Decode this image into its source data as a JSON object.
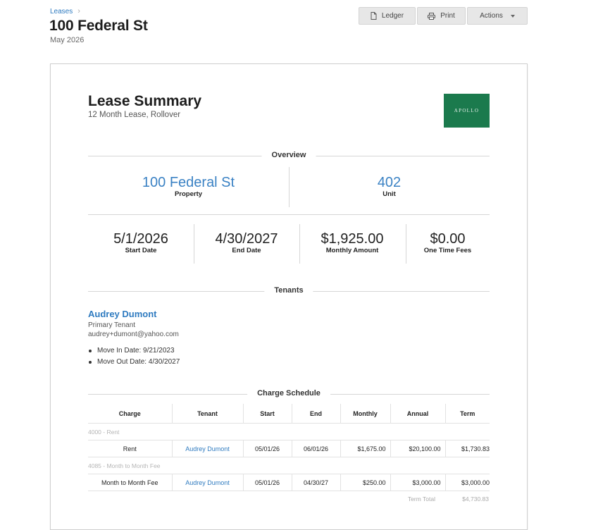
{
  "breadcrumb": {
    "parent": "Leases",
    "separator": "›"
  },
  "header": {
    "title": "100 Federal St",
    "subtitle": "May 2026"
  },
  "toolbar": {
    "ledger_label": "Ledger",
    "print_label": "Print",
    "actions_label": "Actions"
  },
  "document": {
    "title": "Lease Summary",
    "subtitle": "12 Month Lease, Rollover",
    "logo_text": "APOLLO",
    "logo_color": "#1b7a4d",
    "overview": {
      "heading": "Overview",
      "property_value": "100 Federal St",
      "property_label": "Property",
      "unit_value": "402",
      "unit_label": "Unit",
      "start_value": "5/1/2026",
      "start_label": "Start Date",
      "end_value": "4/30/2027",
      "end_label": "End Date",
      "monthly_value": "$1,925.00",
      "monthly_label": "Monthly Amount",
      "fees_value": "$0.00",
      "fees_label": "One Time Fees"
    },
    "tenants": {
      "heading": "Tenants",
      "name": "Audrey Dumont",
      "role": "Primary Tenant",
      "email": "audrey+dumont@yahoo.com",
      "move_in": "Move In Date: 9/21/2023",
      "move_out": "Move Out Date: 4/30/2027"
    },
    "charges": {
      "heading": "Charge Schedule",
      "columns": [
        "Charge",
        "Tenant",
        "Start",
        "End",
        "Monthly",
        "Annual",
        "Term"
      ],
      "groups": [
        {
          "label": "4000 - Rent",
          "row": {
            "charge": "Rent",
            "tenant": "Audrey Dumont",
            "start": "05/01/26",
            "end": "06/01/26",
            "monthly": "$1,675.00",
            "annual": "$20,100.00",
            "term": "$1,730.83"
          }
        },
        {
          "label": "4085 - Month to Month Fee",
          "row": {
            "charge": "Month to Month Fee",
            "tenant": "Audrey Dumont",
            "start": "05/01/26",
            "end": "04/30/27",
            "monthly": "$250.00",
            "annual": "$3,000.00",
            "term": "$3,000.00"
          }
        }
      ],
      "total_label": "Term Total",
      "total_value": "$4,730.83"
    }
  }
}
